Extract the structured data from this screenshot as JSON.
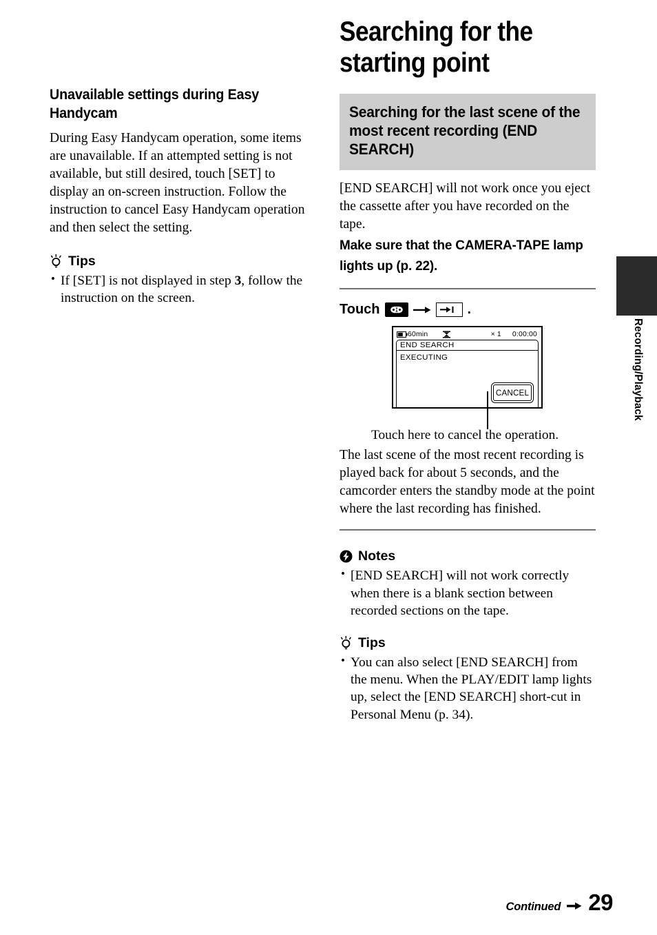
{
  "page_number": "29",
  "footer": {
    "continued_label": "Continued",
    "arrow_icon": "right-arrow-icon"
  },
  "side_tab": {
    "label": "Recording/Playback",
    "color": "#2b2b2b"
  },
  "left_column": {
    "heading": "Unavailable settings during Easy Handycam",
    "paragraph": "During Easy Handycam operation, some items are unavailable. If an attempted setting is not available, but still desired, touch [SET] to display an on-screen instruction. Follow the instruction to cancel Easy Handycam operation and then select the setting.",
    "tips": {
      "icon": "lightbulb-icon",
      "title": "Tips",
      "items": [
        {
          "pre": "If [SET] is not displayed in step ",
          "bold": "3",
          "post": ", follow the instruction on the screen."
        }
      ]
    }
  },
  "right_column": {
    "page_title": "Searching for the starting point",
    "band": {
      "title": "Searching for the last scene of the most recent recording (END SEARCH)",
      "background": "#cdcdcd"
    },
    "intro_paragraph": "[END SEARCH] will not work once you eject the cassette after you have recorded on the tape.",
    "bold_instruction": "Make sure that the CAMERA-TAPE lamp lights up (p. 22).",
    "touch_step": {
      "label": "Touch",
      "icon_1": "cassette-tape-icon",
      "arrow_icon": "right-arrow-icon",
      "icon_2": "end-search-icon",
      "period": "."
    },
    "lcd": {
      "status": {
        "battery_icon": "battery-icon",
        "battery_time": "60min",
        "tape_icon": "tape-transport-icon",
        "zoom": "× 1",
        "timecode": "0:00:00"
      },
      "panel_title": "END  SEARCH",
      "panel_status": "EXECUTING",
      "cancel_button": "CANCEL"
    },
    "lcd_caption": "Touch here to cancel the operation.",
    "result_paragraph": "The last scene of the most recent recording is played back for about 5 seconds, and the camcorder enters the standby mode at the point where the last recording has finished.",
    "notes": {
      "icon": "warning-bolt-icon",
      "title": "Notes",
      "items": [
        "[END SEARCH] will not work correctly when there is a blank section between recorded sections on the tape."
      ]
    },
    "tips": {
      "icon": "lightbulb-icon",
      "title": "Tips",
      "items": [
        "You can also select [END SEARCH] from the menu. When the PLAY/EDIT lamp lights up, select the [END SEARCH] short-cut in Personal Menu (p. 34)."
      ]
    }
  }
}
